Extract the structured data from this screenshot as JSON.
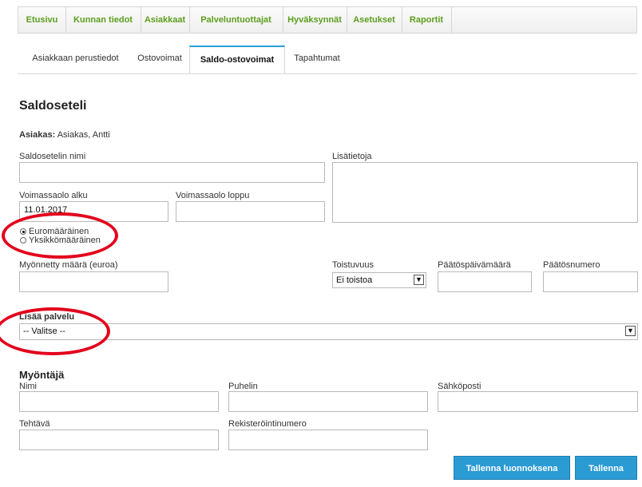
{
  "nav": {
    "items": [
      "Etusivu",
      "Kunnan tiedot",
      "Asiakkaat",
      "Palveluntuottajat",
      "Hyväksynnät",
      "Asetukset",
      "Raportit"
    ]
  },
  "tabs": [
    "Asiakkaan perustiedot",
    "Ostovoimat",
    "Saldo-ostovoimat",
    "Tapahtumat"
  ],
  "page": {
    "title": "Saldoseteli"
  },
  "customer": {
    "label": "Asiakas:",
    "name": "Asiakas, Antti"
  },
  "form": {
    "voucher_name_label": "Saldosetelin nimi",
    "voucher_name_value": "",
    "extra_info_label": "Lisätietoja",
    "valid_from_label": "Voimassaolo alku",
    "valid_from_value": "11.01.2017",
    "valid_to_label": "Voimassaolo loppu",
    "valid_to_value": "",
    "radio_euro": "Euromääräinen",
    "radio_unit": "Yksikkömääräinen",
    "amount_label": "Myönnetty määrä (euroa)",
    "amount_value": "",
    "recurrence_label": "Toistuvuus",
    "recurrence_value": "Ei toistoa",
    "decision_date_label": "Päätöspäivämäärä",
    "decision_number_label": "Päätösnumero",
    "add_service_label": "Lisää palvelu",
    "add_service_value": "-- Valitse --"
  },
  "grantor": {
    "title": "Myöntäjä",
    "name_label": "Nimi",
    "phone_label": "Puhelin",
    "email_label": "Sähköposti",
    "role_label": "Tehtävä",
    "reg_label": "Rekisteröintinumero"
  },
  "buttons": {
    "save_draft": "Tallenna luonnoksena",
    "save": "Tallenna"
  },
  "colors": {
    "nav_text": "#5c9e1e",
    "button": "#2b9bd4",
    "annotation": "#e3001b",
    "active_tab_border": "#2a9fd6"
  }
}
